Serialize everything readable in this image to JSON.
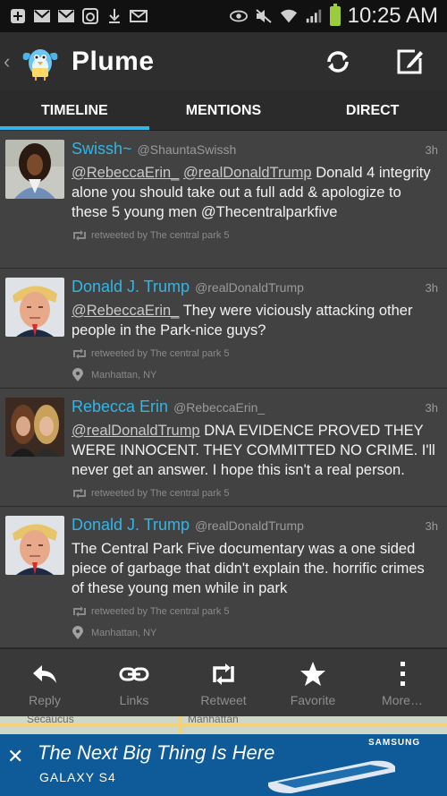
{
  "status_bar": {
    "time": "10:25 AM",
    "icons": [
      "plus-icon",
      "gmail-icon",
      "gmail-icon",
      "instagram-icon",
      "download-icon",
      "email-icon",
      "eye-icon",
      "mute-icon",
      "wifi-icon",
      "signal-icon",
      "battery-icon"
    ]
  },
  "app": {
    "title": "Plume",
    "back_icon": "chevron-left-icon",
    "refresh_icon": "refresh-icon",
    "compose_icon": "compose-icon"
  },
  "tabs": [
    {
      "label": "TIMELINE",
      "active": true
    },
    {
      "label": "MENTIONS",
      "active": false
    },
    {
      "label": "DIRECT",
      "active": false
    }
  ],
  "tweets": [
    {
      "name": "Swissh~",
      "handle": "@ShauntaSwissh",
      "time": "3h",
      "mentions": [
        "@RebeccaErin_",
        "@realDonaldTrump"
      ],
      "text": "Donald 4 integrity alone you should take out a full add & apologize to these 5 young men @Thecentralparkfive",
      "retweeted_by": "retweeted by The central park 5",
      "location": ""
    },
    {
      "name": "Donald J. Trump",
      "handle": "@realDonaldTrump",
      "time": "3h",
      "mentions": [
        "@RebeccaErin_"
      ],
      "text": "They were viciously attacking other people in the Park-nice guys?",
      "retweeted_by": "retweeted by The central park 5",
      "location": "Manhattan, NY"
    },
    {
      "name": "Rebecca Erin",
      "handle": "@RebeccaErin_",
      "time": "3h",
      "mentions": [
        "@realDonaldTrump"
      ],
      "text": "DNA EVIDENCE PROVED THEY WERE INNOCENT. THEY COMMITTED NO CRIME. I'll never get an answer. I hope this isn't a real person.",
      "retweeted_by": "retweeted by The central park 5",
      "location": ""
    },
    {
      "name": "Donald J. Trump",
      "handle": "@realDonaldTrump",
      "time": "3h",
      "mentions": [],
      "text": "The Central Park Five documentary  was a one sided piece of garbage that didn't explain the. horrific crimes of these young men while in park",
      "retweeted_by": "retweeted by The central park 5",
      "location": "Manhattan, NY"
    }
  ],
  "actions": [
    {
      "label": "Reply",
      "icon": "reply-icon"
    },
    {
      "label": "Links",
      "icon": "link-icon"
    },
    {
      "label": "Retweet",
      "icon": "retweet-icon"
    },
    {
      "label": "Favorite",
      "icon": "star-icon"
    },
    {
      "label": "More…",
      "icon": "more-icon"
    }
  ],
  "map": {
    "labels": [
      "Secaucus",
      "Manhattan"
    ]
  },
  "ad": {
    "headline": "The Next Big Thing Is Here",
    "product": "GALAXY S4",
    "brand": "SAMSUNG",
    "close_icon": "close-icon"
  },
  "colors": {
    "accent": "#33b5e5",
    "background": "#424242",
    "appbar": "#2e2e2e"
  }
}
